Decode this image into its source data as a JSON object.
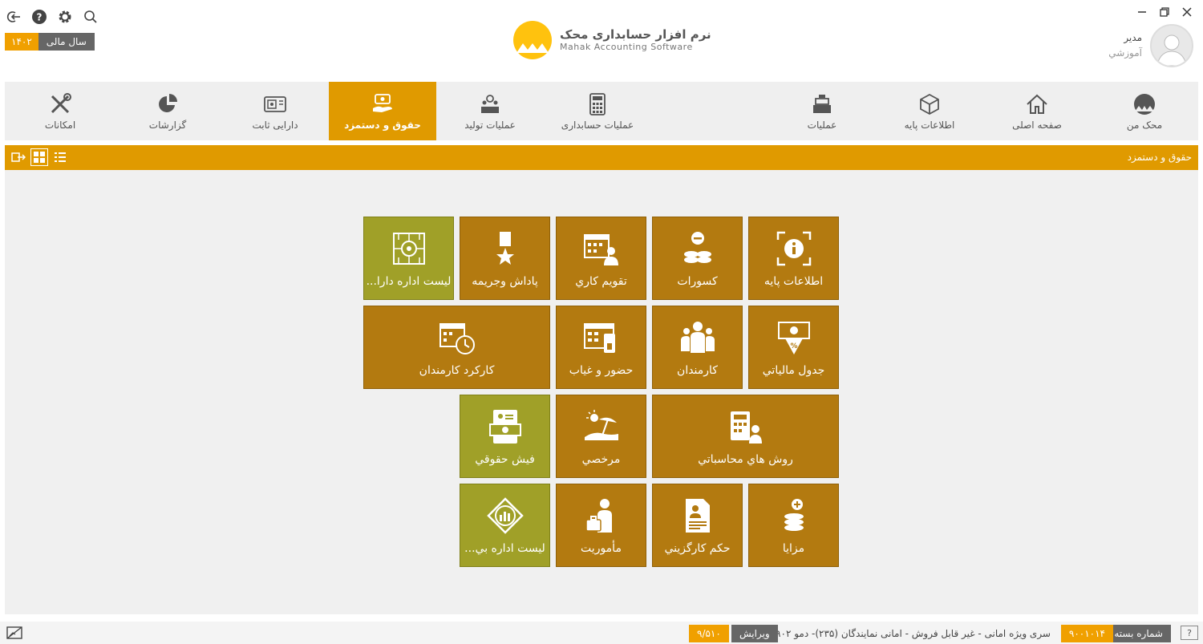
{
  "header": {
    "logo_fa": "نرم افزار حسابداری محک",
    "logo_en": "Mahak Accounting Software",
    "user_name": "مدیر",
    "user_role": "آموزشي",
    "fiscal_label": "سال مالی",
    "fiscal_year": "۱۴۰۲"
  },
  "nav": {
    "items": [
      {
        "label": "محک من",
        "icon": "mahak-icon"
      },
      {
        "label": "صفحه اصلی",
        "icon": "home-icon"
      },
      {
        "label": "اطلاعات پایه",
        "icon": "box-icon"
      },
      {
        "label": "عملیات",
        "icon": "cash-register-icon"
      },
      {
        "label": "عملیات حسابداری",
        "icon": "calculator-icon"
      },
      {
        "label": "عملیات تولید",
        "icon": "factory-icon"
      },
      {
        "label": "حقوق و دستمزد",
        "icon": "salary-icon",
        "active": true
      },
      {
        "label": "دارایی ثابت",
        "icon": "safe-icon"
      },
      {
        "label": "گزارشات",
        "icon": "chart-icon"
      },
      {
        "label": "امکانات",
        "icon": "tools-icon"
      }
    ]
  },
  "breadcrumb": "حقوق و دستمزد",
  "tiles": [
    {
      "label": "اطلاعات پايه",
      "icon": "info-icon",
      "color": "brown"
    },
    {
      "label": "کسورات",
      "icon": "coins-minus-icon",
      "color": "brown"
    },
    {
      "label": "تقويم کاري",
      "icon": "calendar-person-icon",
      "color": "brown"
    },
    {
      "label": "پاداش وجريمه",
      "icon": "medal-icon",
      "color": "brown"
    },
    {
      "label": "ليست اداره دارا...",
      "icon": "chip-icon",
      "color": "green"
    },
    {
      "label": "جدول مالياتي",
      "icon": "tax-table-icon",
      "color": "brown"
    },
    {
      "label": "کارمندان",
      "icon": "employees-icon",
      "color": "brown"
    },
    {
      "label": "حضور و غياب",
      "icon": "attendance-icon",
      "color": "brown"
    },
    {
      "label": "کارکرد کارمندان",
      "icon": "calendar-clock-icon",
      "color": "brown"
    },
    {
      "label": "روش هاي محاسباتي",
      "icon": "calc-person-icon",
      "color": "brown"
    },
    {
      "label": "مرخصي",
      "icon": "beach-icon",
      "color": "brown"
    },
    {
      "label": "فيش حقوقي",
      "icon": "payslip-icon",
      "color": "green"
    },
    {
      "label": "مزايا",
      "icon": "coins-plus-icon",
      "color": "brown"
    },
    {
      "label": "حکم کارگزيني",
      "icon": "document-person-icon",
      "color": "brown"
    },
    {
      "label": "مأموريت",
      "icon": "briefcase-person-icon",
      "color": "brown"
    },
    {
      "label": "ليست اداره بي...",
      "icon": "insurance-icon",
      "color": "green"
    }
  ],
  "status": {
    "package_label": "شماره بسته",
    "package_value": "۹۰۰۱۰۱۴",
    "series_text": "سری ویژه امانی - غیر قابل فروش - امانی نمایندگان (۲۳۵)- دمو ۹۰۲",
    "version_label": "ویرایش",
    "version_value": "۹/۵۱۰",
    "help": "?"
  },
  "colors": {
    "accent": "#e09a00",
    "tile_brown": "#b37a10",
    "tile_green": "#a0a028"
  }
}
